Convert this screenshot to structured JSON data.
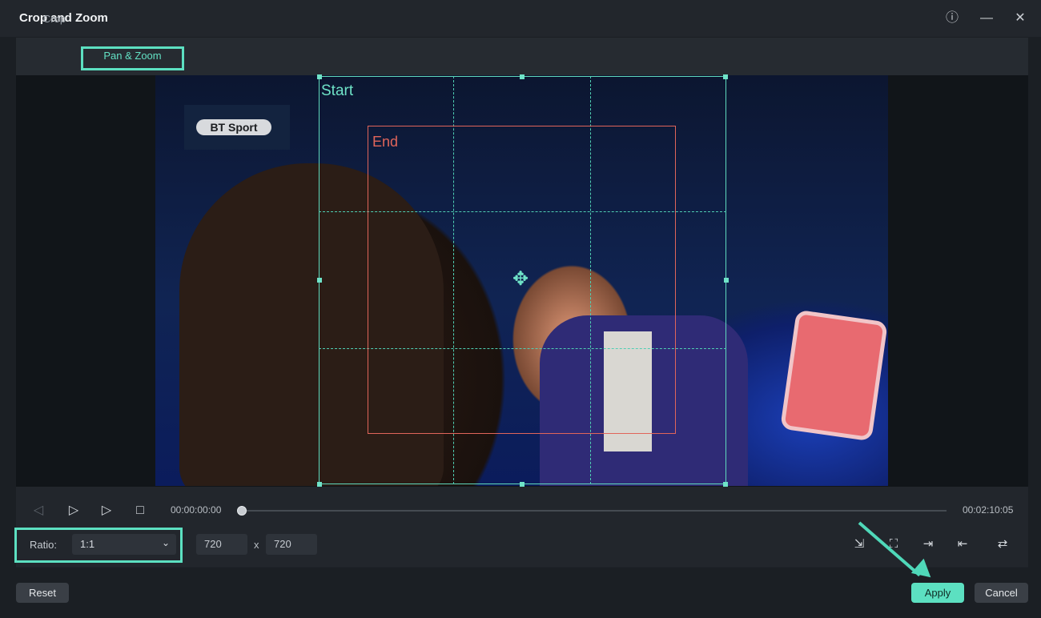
{
  "window": {
    "title": "Crop and Zoom"
  },
  "tabs": [
    {
      "label": "Crop"
    },
    {
      "label": "Pan & Zoom"
    }
  ],
  "video": {
    "logo_text": "BT Sport",
    "start_label": "Start",
    "end_label": "End"
  },
  "player": {
    "current_time": "00:00:00:00",
    "total_time": "00:02:10:05",
    "progress": 0
  },
  "ratio": {
    "label": "Ratio:",
    "value": "1:1"
  },
  "size": {
    "width": "720",
    "separator": "x",
    "height": "720"
  },
  "buttons": {
    "reset": "Reset",
    "apply": "Apply",
    "cancel": "Cancel"
  },
  "colors": {
    "accent": "#5ce0c1",
    "end_box": "#e0655a",
    "bg": "#1b1f24"
  }
}
